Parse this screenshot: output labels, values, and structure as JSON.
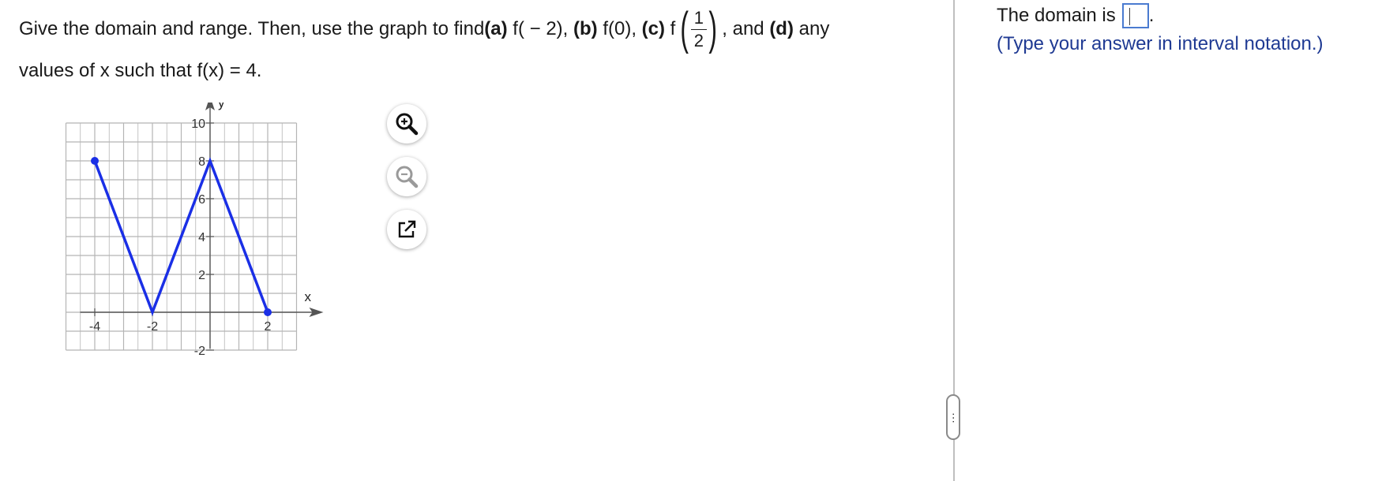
{
  "question": {
    "line1_start": "Give the domain and range. Then, use the graph to find ",
    "part_a_label": "(a)",
    "part_a_expr": " f( − 2), ",
    "part_b_label": "(b)",
    "part_b_expr": " f(0), ",
    "part_c_label": "(c)",
    "part_c_f": " f",
    "frac_num": "1",
    "frac_den": "2",
    "and_text": ", and ",
    "part_d_label": "(d)",
    "part_d_expr": " any",
    "line2": "values of x such that f(x) = 4."
  },
  "graph": {
    "x_axis_label": "x",
    "y_axis_label": "y",
    "x_ticks": [
      "-4",
      "-2",
      "2"
    ],
    "y_ticks": [
      "10",
      "8",
      "6",
      "4",
      "2",
      "-2"
    ],
    "line_color": "#1a2fe6",
    "points": [
      {
        "x": -4,
        "y": 8,
        "endpoint": true
      },
      {
        "x": -2,
        "y": 0,
        "endpoint": false
      },
      {
        "x": 0,
        "y": 8,
        "endpoint": false
      },
      {
        "x": 2,
        "y": 0,
        "endpoint": true
      }
    ]
  },
  "tools": {
    "zoom_in": "zoom-in-icon",
    "zoom_out": "zoom-out-icon",
    "popout": "popout-icon"
  },
  "answer": {
    "prompt": "The domain is",
    "period": ".",
    "hint": "(Type your answer in interval notation.)"
  },
  "splitter_label": "⋯"
}
